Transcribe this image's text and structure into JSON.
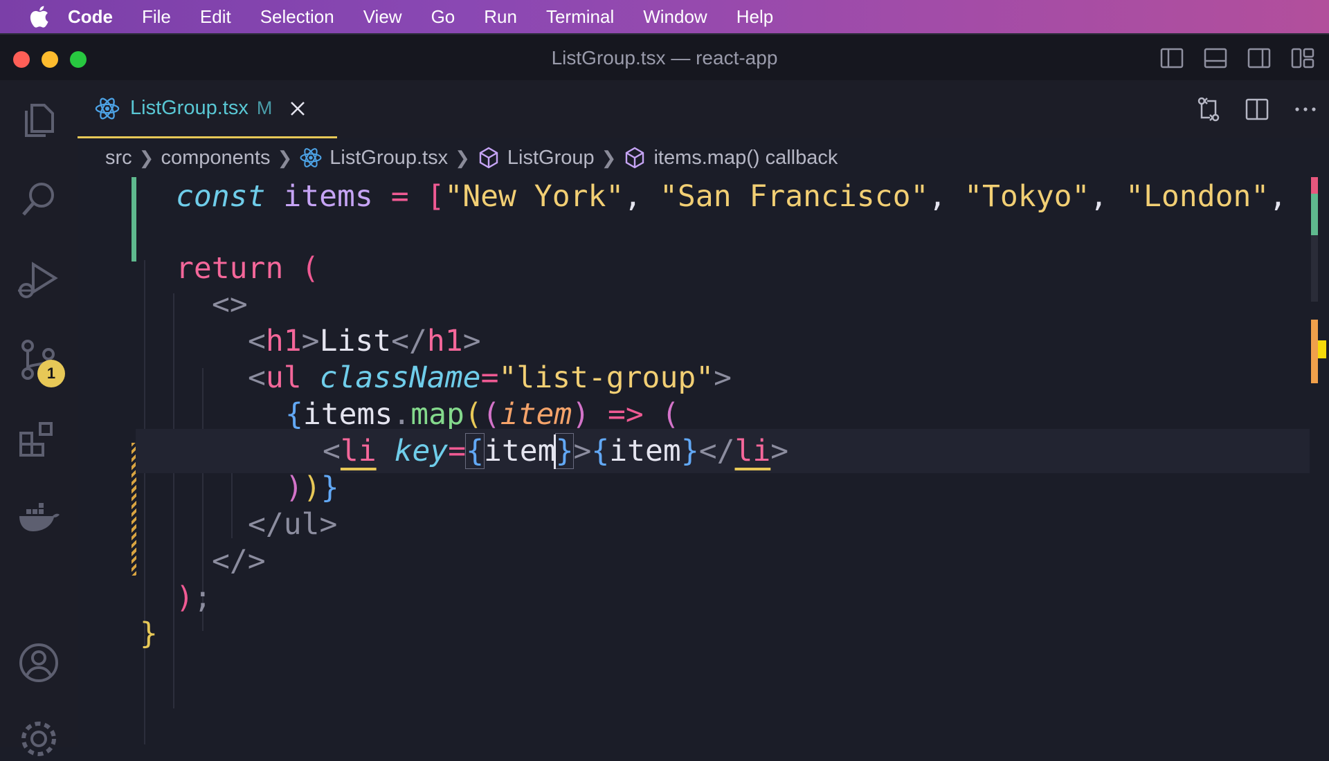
{
  "menubar": {
    "app": "Code",
    "items": [
      "File",
      "Edit",
      "Selection",
      "View",
      "Go",
      "Run",
      "Terminal",
      "Window",
      "Help"
    ]
  },
  "window": {
    "title": "ListGroup.tsx — react-app"
  },
  "activity_bar": {
    "items": [
      "files-icon",
      "search-icon",
      "run-debug-icon",
      "source-control-icon",
      "extensions-icon",
      "docker-icon",
      "account-icon",
      "settings-icon"
    ],
    "source_control_badge": "1"
  },
  "tab": {
    "name": "ListGroup.tsx",
    "status": "M"
  },
  "breadcrumb": [
    "src",
    "components",
    "ListGroup.tsx",
    "ListGroup",
    "items.map() callback"
  ],
  "code": {
    "l1": {
      "kw": "const",
      "name": "items",
      "eq": "=",
      "open": "[",
      "s1": "\"New York\"",
      "s2": "\"San Francisco\"",
      "s3": "\"Tokyo\"",
      "s4": "\"London\"",
      "comma": ","
    },
    "l3": {
      "kw": "return",
      "paren": "("
    },
    "l4": "<>",
    "l5": {
      "lt": "<",
      "tag": "h1",
      "gt": ">",
      "text": "List",
      "close_lt": "</",
      "close_tag": "h1",
      "close_gt": ">"
    },
    "l6": {
      "lt": "<",
      "tag": "ul",
      "attr": "className",
      "eq": "=",
      "val": "\"list-group\"",
      "gt": ">"
    },
    "l7": {
      "brace": "{",
      "obj": "items",
      "dot": ".",
      "fn": "map",
      "p1": "(",
      "p2": "(",
      "param": "item",
      "p3": ")",
      "arrow": "=>",
      "p4": "("
    },
    "l8": {
      "lt": "<",
      "tag": "li",
      "attr": "key",
      "eq": "=",
      "b1": "{",
      "expr": "item",
      "b2": "}",
      "gt": ">",
      "b3": "{",
      "expr2": "item",
      "b4": "}",
      "close_lt": "</",
      "close_tag": "li",
      "close_gt": ">"
    },
    "l9": {
      "p1": ")",
      "p2": ")",
      "brace": "}"
    },
    "l10": "</ul>",
    "l11": "</>",
    "l12": {
      "paren": ")",
      "semi": ";"
    },
    "l13": "}"
  }
}
